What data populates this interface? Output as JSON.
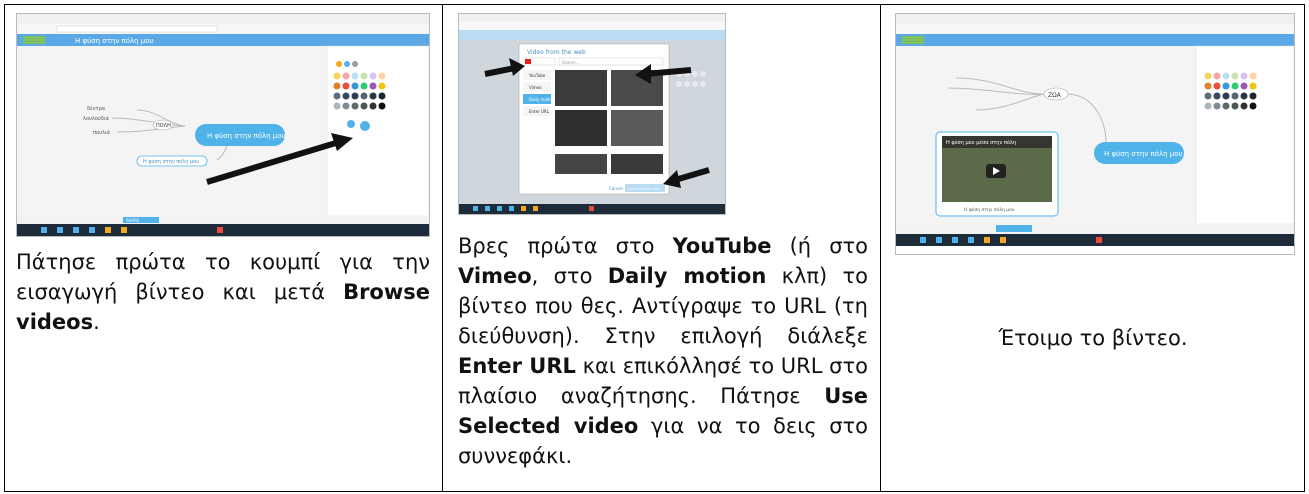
{
  "columns": [
    {
      "screenshot": {
        "center_bubble": "Η φύση στην πόλη μου",
        "toolbar_title": "Η φύση στην πόλη μου",
        "side_node": "ΠΟΛΗ",
        "share_label": "SHARE",
        "pill_label": "Η φύση στην πόλη μου",
        "leaf_nodes": [
          "δέντρα",
          "λουλούδια",
          "πουλιά"
        ]
      },
      "caption": {
        "p1": "Πάτησε πρώτα το κουμπί για την εισαγωγή βίντεο και μετά ",
        "b1": "Browse videos",
        "p2": "."
      }
    },
    {
      "screenshot": {
        "dialog_title": "Video from the web",
        "services": [
          "YouTube",
          "Vimeo",
          "Daily motion",
          "Enter URL"
        ],
        "search_placeholder": "Search...",
        "cancel_label": "Cancel",
        "use_label": "Use selected video"
      },
      "caption": {
        "p1": "Βρες πρώτα στο ",
        "b1": "YouTube",
        "p2": " (ή στο ",
        "b2": "Vimeo",
        "p3": ", στο ",
        "b3": "Daily motion",
        "p4": " κλπ) το βίντεο που θες. Αντίγραψε το URL (τη διεύθυνση). Στην επιλογή διάλεξε ",
        "b4": "Enter URL",
        "p5": " και επικόλλησέ το URL στο πλαίσιο αναζήτησης. Πάτησε ",
        "b5": "Use Selected video",
        "p6": " για να το δεις στο συννεφάκι."
      }
    },
    {
      "screenshot": {
        "center_bubble": "Η φύση στην πόλη μου",
        "side_node": "ΖΩΑ",
        "video_title": "Η φύση μου μέσα στην πόλη",
        "video_caption": "Η φύση στην πόλη μου"
      },
      "caption": {
        "p1": "Έτοιμο το βίντεο."
      }
    }
  ],
  "colors": {
    "accent": "#4fb3ea",
    "toolbar": "#5aa9e6",
    "taskbar": "#1d2b3a",
    "arrow": "#111111"
  }
}
